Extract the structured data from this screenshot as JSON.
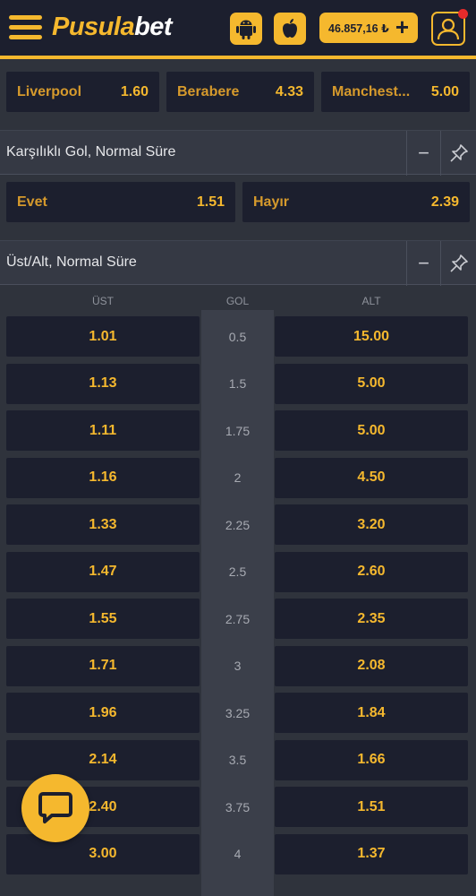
{
  "header": {
    "logo_part1": "Pusula",
    "logo_part2": "bet",
    "balance": "46.857,16 ₺",
    "plus_symbol": "+",
    "icons": [
      "menu-icon",
      "android-icon",
      "apple-icon",
      "plus-icon",
      "user-icon"
    ]
  },
  "match_result": [
    {
      "name": "Liverpool",
      "odd": "1.60"
    },
    {
      "name": "Berabere",
      "odd": "4.33"
    },
    {
      "name": "Manchest...",
      "odd": "5.00"
    }
  ],
  "btts": {
    "title": "Karşılıklı Gol, Normal Süre",
    "collapse_symbol": "−",
    "options": [
      {
        "name": "Evet",
        "odd": "1.51"
      },
      {
        "name": "Hayır",
        "odd": "2.39"
      }
    ]
  },
  "over_under": {
    "title": "Üst/Alt, Normal Süre",
    "collapse_symbol": "−",
    "headers": {
      "over": "ÜST",
      "goal": "GOL",
      "under": "ALT"
    },
    "rows": [
      {
        "over": "1.01",
        "goal": "0.5",
        "under": "15.00"
      },
      {
        "over": "1.13",
        "goal": "1.5",
        "under": "5.00"
      },
      {
        "over": "1.11",
        "goal": "1.75",
        "under": "5.00"
      },
      {
        "over": "1.16",
        "goal": "2",
        "under": "4.50"
      },
      {
        "over": "1.33",
        "goal": "2.25",
        "under": "3.20"
      },
      {
        "over": "1.47",
        "goal": "2.5",
        "under": "2.60"
      },
      {
        "over": "1.55",
        "goal": "2.75",
        "under": "2.35"
      },
      {
        "over": "1.71",
        "goal": "3",
        "under": "2.08"
      },
      {
        "over": "1.96",
        "goal": "3.25",
        "under": "1.84"
      },
      {
        "over": "2.14",
        "goal": "3.5",
        "under": "1.66"
      },
      {
        "over": "2.40",
        "goal": "3.75",
        "under": "1.51"
      },
      {
        "over": "3.00",
        "goal": "4",
        "under": "1.37"
      }
    ]
  },
  "colors": {
    "accent": "#f5b82e",
    "button_bg": "#1c1f2e",
    "page_bg": "#2f333c"
  }
}
